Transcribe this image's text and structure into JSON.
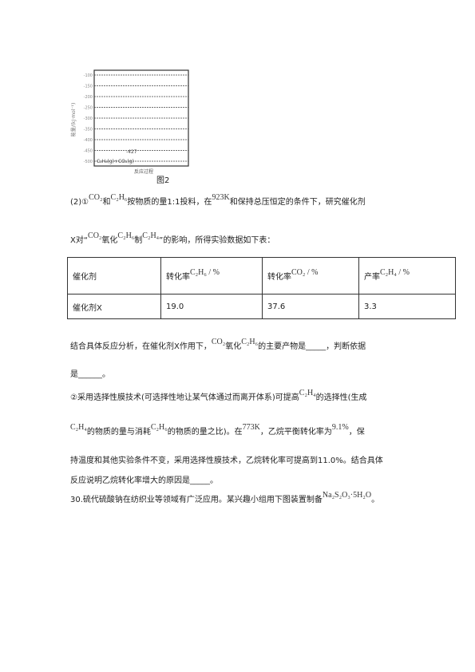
{
  "figure": {
    "ylabel": "能量/(kJ·mol⁻¹)",
    "ticks": [
      "-100",
      "-150",
      "-200",
      "-250",
      "-300",
      "-350",
      "-400",
      "-450",
      "-500"
    ],
    "value_label": "-427",
    "state_label": "C₂H₆(g)+CO₂(g)",
    "xlabel": "反应过程",
    "caption": "图2"
  },
  "p1": {
    "a": "(2)①",
    "f1": "CO₂",
    "b": "和",
    "f2": "C₂H₆",
    "c": "按物质的量1:1投料，在",
    "f3": "923K",
    "d": "和保持总压恒定的条件下，研究催化剂"
  },
  "p2": {
    "a": "X对“",
    "f1": "CO₂",
    "b": "氧化",
    "f2": "C₂H₆",
    "c": "制",
    "f3": "C₂H₄",
    "d": "”的影响，所得实验数据如下表："
  },
  "table": {
    "headers": [
      "催化剂",
      "转化率",
      "转化率",
      "产率"
    ],
    "header_formulas": [
      "",
      "C₂H₆ / %",
      "CO₂ / %",
      "C₂H₄ / %"
    ],
    "row": [
      "催化剂X",
      "19.0",
      "37.6",
      "3.3"
    ]
  },
  "p3": {
    "a": "结合具体反应分析，在催化剂X作用下，",
    "f1": "CO₂",
    "b": "氧化",
    "f2": "C₂H₆",
    "c": "的主要产物是_____，判断依据"
  },
  "p4": "是______。",
  "p5": {
    "a": "②采用选择性膜技术(可选择性地让某气体通过而离开体系)可提高",
    "f1": "C₂H₄",
    "b": "的选择性(生成"
  },
  "p6": {
    "f1": "C₂H₄",
    "a": "的物质的量与消耗",
    "f2": "C₂H₆",
    "b": "的物质的量之比)。在",
    "f3": "773K",
    "c": "，乙烷平衡转化率为",
    "f4": "9.1%",
    "d": "，保"
  },
  "p7": "持温度和其他实验条件不变，采用选择性膜技术，乙烷转化率可提高到11.0%。结合具体",
  "p8": "反应说明乙烷转化率增大的原因是_____。",
  "p9": {
    "a": "30.硫代硫酸钠在纺织业等领域有广泛应用。某兴趣小组用下图装置制备",
    "f1": "Na₂S₂O₃·5H₂O",
    "b": "。"
  }
}
